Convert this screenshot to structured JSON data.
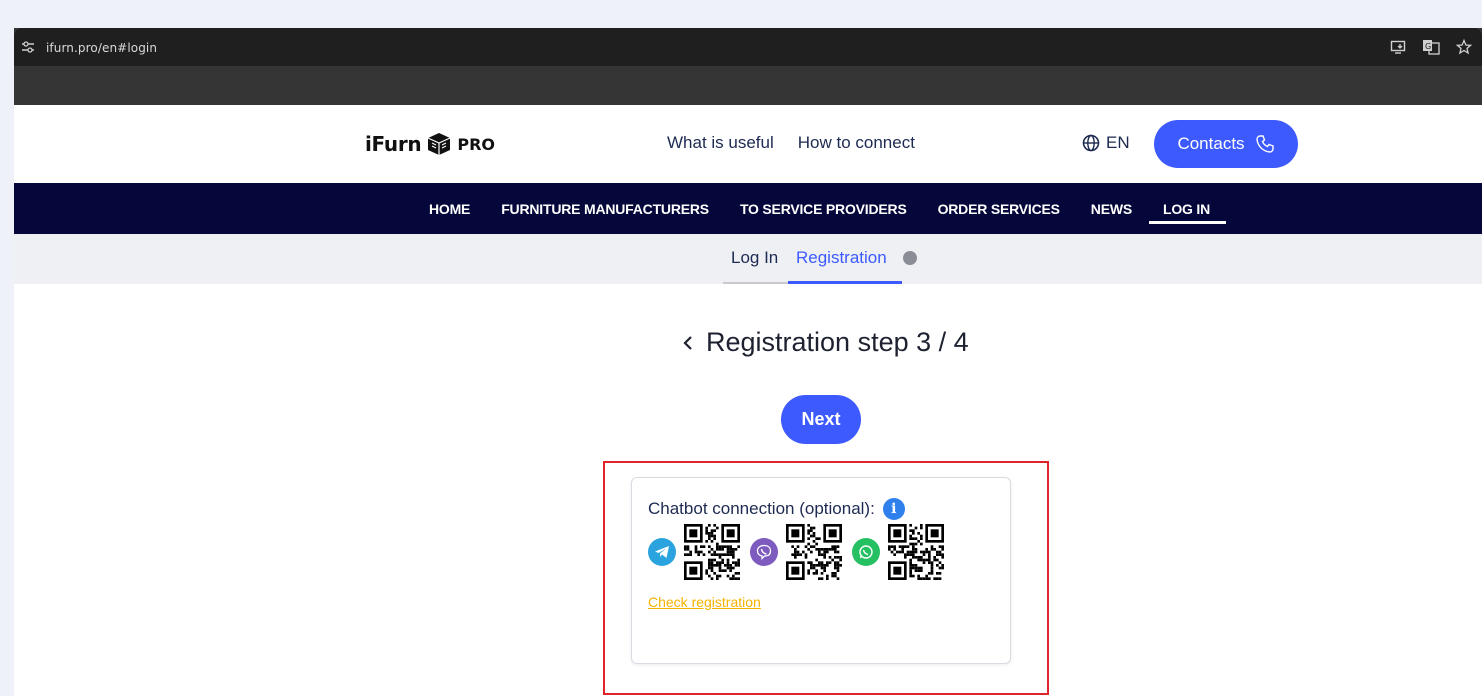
{
  "browser": {
    "url": "ifurn.pro/en#login"
  },
  "header": {
    "logo_text": "iFurn",
    "logo_suffix": "PRO",
    "links": [
      "What is useful",
      "How to connect"
    ],
    "lang": "EN",
    "contacts_label": "Contacts"
  },
  "nav": {
    "items": [
      "HOME",
      "FURNITURE MANUFACTURERS",
      "TO SERVICE PROVIDERS",
      "ORDER SERVICES",
      "NEWS",
      "LOG IN"
    ],
    "active": "LOG IN"
  },
  "subtabs": {
    "login": "Log In",
    "registration": "Registration"
  },
  "registration": {
    "title": "Registration step 3 / 4",
    "next_label": "Next"
  },
  "chatbot": {
    "title": "Chatbot connection (optional):",
    "bots": [
      {
        "name": "telegram-icon",
        "color": "#2aa3df"
      },
      {
        "name": "viber-icon",
        "color": "#7d5bbf"
      },
      {
        "name": "whatsapp-icon",
        "color": "#25c061"
      }
    ],
    "check_link": "Check registration"
  }
}
